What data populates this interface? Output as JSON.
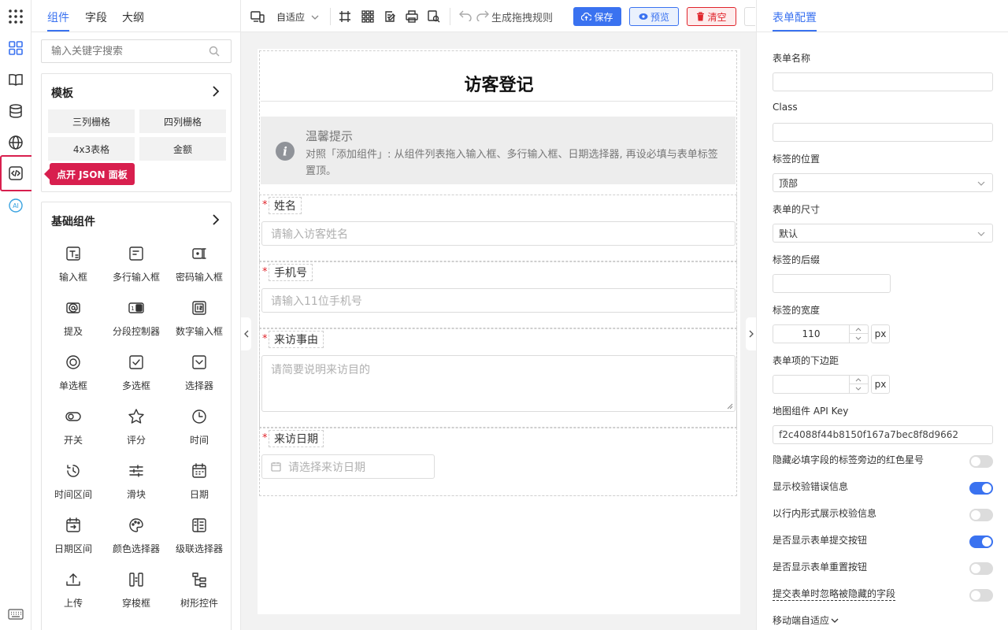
{
  "panel_tabs": [
    "组件",
    "字段",
    "大纲"
  ],
  "search": {
    "placeholder": "输入关键字搜索"
  },
  "templates": {
    "title": "模板",
    "items": [
      "三列栅格",
      "四列栅格",
      "4x3表格",
      "金额"
    ]
  },
  "tooltip": "点开 JSON 面板",
  "basic": {
    "title": "基础组件",
    "items": [
      {
        "label": "输入框",
        "icon": "text-input-icon"
      },
      {
        "label": "多行输入框",
        "icon": "textarea-icon"
      },
      {
        "label": "密码输入框",
        "icon": "password-icon"
      },
      {
        "label": "提及",
        "icon": "mention-icon"
      },
      {
        "label": "分段控制器",
        "icon": "segmented-icon"
      },
      {
        "label": "数字输入框",
        "icon": "number-input-icon"
      },
      {
        "label": "单选框",
        "icon": "radio-icon"
      },
      {
        "label": "多选框",
        "icon": "checkbox-icon"
      },
      {
        "label": "选择器",
        "icon": "select-icon"
      },
      {
        "label": "开关",
        "icon": "switch-icon"
      },
      {
        "label": "评分",
        "icon": "star-icon"
      },
      {
        "label": "时间",
        "icon": "clock-icon"
      },
      {
        "label": "时间区间",
        "icon": "time-range-icon"
      },
      {
        "label": "滑块",
        "icon": "slider-icon"
      },
      {
        "label": "日期",
        "icon": "calendar-icon"
      },
      {
        "label": "日期区间",
        "icon": "date-range-icon"
      },
      {
        "label": "颜色选择器",
        "icon": "palette-icon"
      },
      {
        "label": "级联选择器",
        "icon": "cascader-icon"
      },
      {
        "label": "上传",
        "icon": "upload-icon"
      },
      {
        "label": "穿梭框",
        "icon": "transfer-icon"
      },
      {
        "label": "树形控件",
        "icon": "tree-icon"
      }
    ]
  },
  "toolbar": {
    "device": "自适应",
    "rules": "生成拖拽规则",
    "save": "保存",
    "preview": "预览",
    "clear": "清空"
  },
  "form": {
    "title": "访客登记",
    "alert": {
      "title": "温馨提示",
      "text": "对照「添加组件」: 从组件列表拖入输入框、多行输入框、日期选择器, 再设必填与表单标签置顶。"
    },
    "fields": [
      {
        "label": "姓名",
        "placeholder": "请输入访客姓名"
      },
      {
        "label": "手机号",
        "placeholder": "请输入11位手机号"
      },
      {
        "label": "来访事由",
        "placeholder": "请简要说明来访目的"
      },
      {
        "label": "来访日期",
        "placeholder": "请选择来访日期"
      }
    ]
  },
  "config": {
    "tab": "表单配置",
    "form_name_label": "表单名称",
    "form_name_value": "",
    "class_label": "Class",
    "class_value": "",
    "label_position_label": "标签的位置",
    "label_position_value": "顶部",
    "form_size_label": "表单的尺寸",
    "form_size_value": "默认",
    "label_suffix_label": "标签的后缀",
    "label_width_label": "标签的宽度",
    "label_width_value": "110",
    "unit": "px",
    "item_margin_label": "表单项的下边距",
    "map_key_label": "地图组件 API Key",
    "map_key_value": "f2c4088f44b8150f167a7bec8f8d9662",
    "toggles": [
      {
        "label": "隐藏必填字段的标签旁边的红色星号",
        "on": false
      },
      {
        "label": "显示校验错误信息",
        "on": true
      },
      {
        "label": "以行内形式展示校验信息",
        "on": false
      },
      {
        "label": "是否显示表单提交按钮",
        "on": true
      },
      {
        "label": "是否显示表单重置按钮",
        "on": false
      },
      {
        "label": "提交表单时忽略被隐藏的字段",
        "on": false
      }
    ],
    "mobile_label": "移动端自适应"
  },
  "colors": {
    "accent": "#3a72f0",
    "danger": "#e0242b",
    "highlight": "#d81f4e"
  }
}
